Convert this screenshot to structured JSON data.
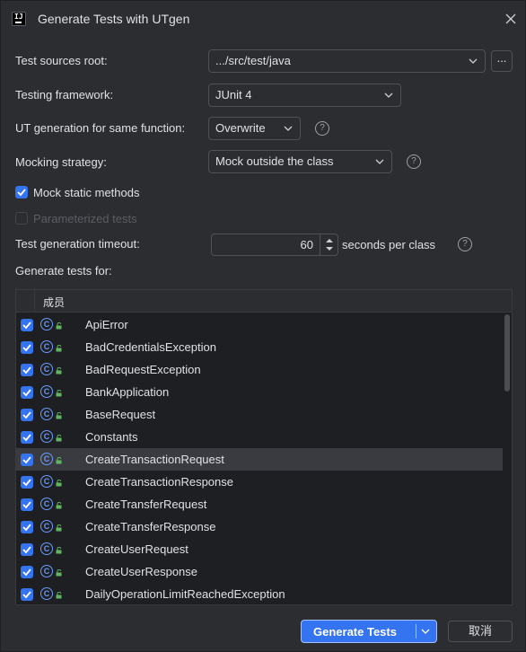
{
  "window": {
    "title": "Generate Tests with UTgen",
    "app_icon": "IJ"
  },
  "form": {
    "sources_root_label": "Test sources root:",
    "sources_root_value": ".../src/test/java",
    "ellipsis_label": "...",
    "framework_label": "Testing framework:",
    "framework_value": "JUnit 4",
    "same_function_label": "UT generation for same function:",
    "same_function_value": "Overwrite",
    "mocking_label": "Mocking strategy:",
    "mocking_value": "Mock outside the class",
    "mock_static_label": "Mock static methods",
    "mock_static_checked": true,
    "parameterized_label": "Parameterized tests",
    "parameterized_checked": false,
    "timeout_label": "Test generation timeout:",
    "timeout_value": "60",
    "timeout_unit": "seconds per class",
    "generate_for_label": "Generate tests for:",
    "help_glyph": "?"
  },
  "table": {
    "header": "成员",
    "class_glyph": "C",
    "rows": [
      {
        "name": "ApiError",
        "checked": true
      },
      {
        "name": "BadCredentialsException",
        "checked": true
      },
      {
        "name": "BadRequestException",
        "checked": true
      },
      {
        "name": "BankApplication",
        "checked": true
      },
      {
        "name": "BaseRequest",
        "checked": true
      },
      {
        "name": "Constants",
        "checked": true
      },
      {
        "name": "CreateTransactionRequest",
        "checked": true,
        "selected": true
      },
      {
        "name": "CreateTransactionResponse",
        "checked": true
      },
      {
        "name": "CreateTransferRequest",
        "checked": true
      },
      {
        "name": "CreateTransferResponse",
        "checked": true
      },
      {
        "name": "CreateUserRequest",
        "checked": true
      },
      {
        "name": "CreateUserResponse",
        "checked": true
      },
      {
        "name": "DailyOperationLimitReachedException",
        "checked": true
      }
    ]
  },
  "buttons": {
    "generate_label": "Generate Tests",
    "cancel_label": "取消"
  },
  "colors": {
    "background": "#2b2d30",
    "accent": "#3574f0",
    "class_icon": "#6b9bfa",
    "lock_icon": "#5fb85f"
  }
}
